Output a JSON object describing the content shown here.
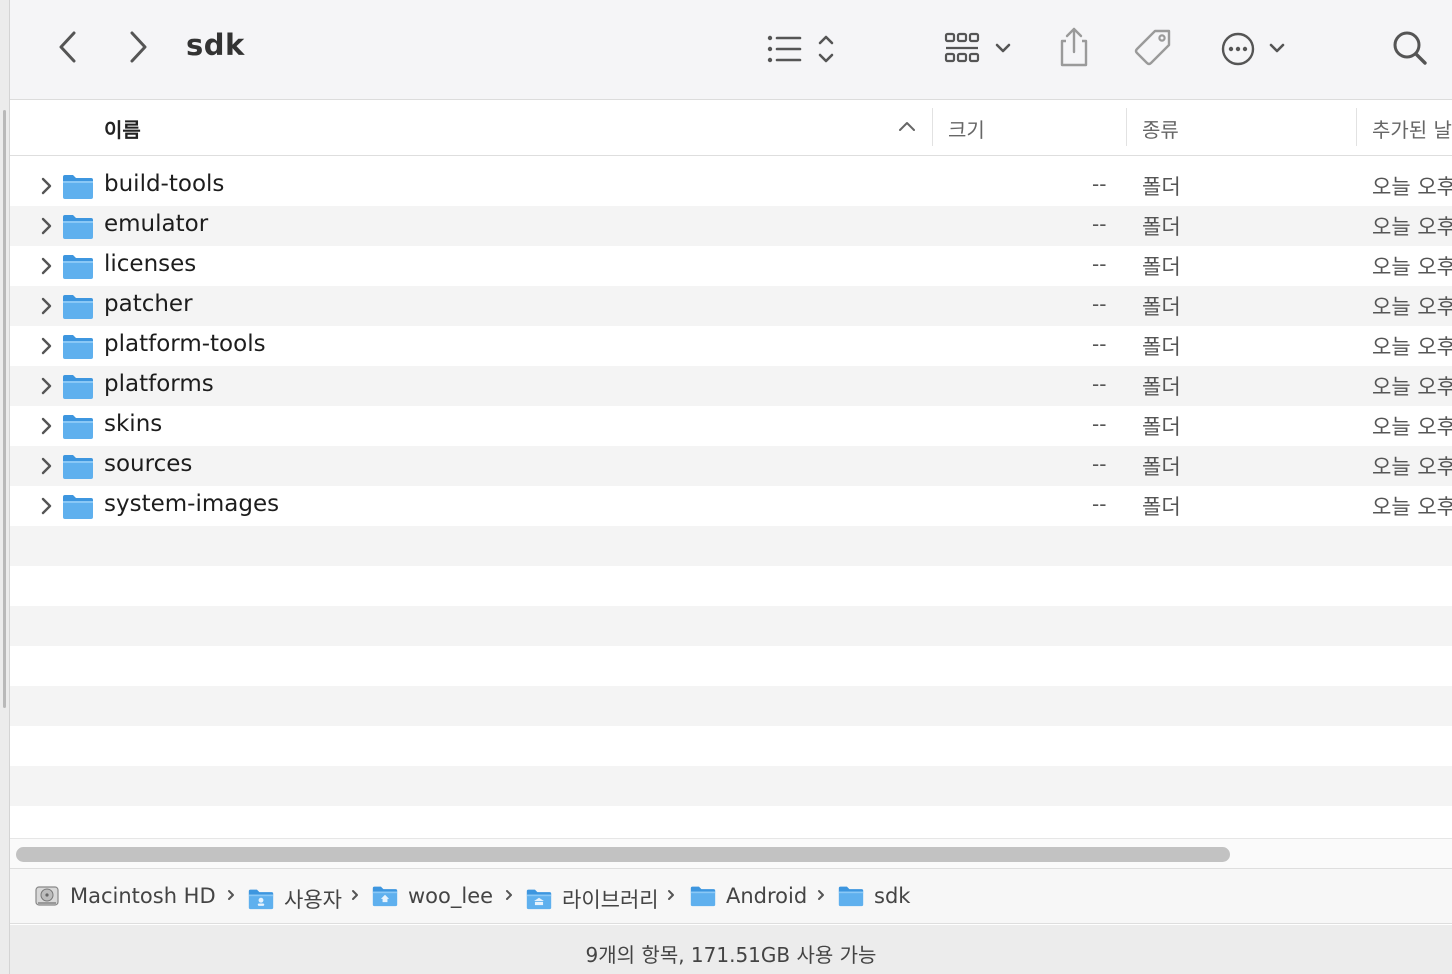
{
  "window": {
    "title": "sdk"
  },
  "toolbar": {
    "back_icon": "chevron-left-icon",
    "forward_icon": "chevron-right-icon",
    "view_list_icon": "list-view-icon",
    "group_icon": "icon-grid-icon",
    "share_icon": "share-icon",
    "tag_icon": "tag-icon",
    "more_icon": "ellipsis-circle-icon",
    "search_icon": "search-icon"
  },
  "columns": {
    "name": "이름",
    "size": "크기",
    "kind": "종류",
    "date_added": "추가된 날"
  },
  "files": [
    {
      "name": "build-tools",
      "size": "--",
      "kind": "폴더",
      "date": "오늘 오후"
    },
    {
      "name": "emulator",
      "size": "--",
      "kind": "폴더",
      "date": "오늘 오후"
    },
    {
      "name": "licenses",
      "size": "--",
      "kind": "폴더",
      "date": "오늘 오후"
    },
    {
      "name": "patcher",
      "size": "--",
      "kind": "폴더",
      "date": "오늘 오후"
    },
    {
      "name": "platform-tools",
      "size": "--",
      "kind": "폴더",
      "date": "오늘 오후"
    },
    {
      "name": "platforms",
      "size": "--",
      "kind": "폴더",
      "date": "오늘 오후"
    },
    {
      "name": "skins",
      "size": "--",
      "kind": "폴더",
      "date": "오늘 오후"
    },
    {
      "name": "sources",
      "size": "--",
      "kind": "폴더",
      "date": "오늘 오후"
    },
    {
      "name": "system-images",
      "size": "--",
      "kind": "폴더",
      "date": "오늘 오후"
    }
  ],
  "pathbar": {
    "items": [
      {
        "label": "Macintosh HD",
        "icon": "hard-drive-icon"
      },
      {
        "label": "사용자",
        "icon": "users-folder-icon"
      },
      {
        "label": "woo_lee",
        "icon": "home-folder-icon"
      },
      {
        "label": "라이브러리",
        "icon": "library-folder-icon"
      },
      {
        "label": "Android",
        "icon": "folder-icon"
      },
      {
        "label": "sdk",
        "icon": "folder-icon"
      }
    ]
  },
  "status": {
    "text": "9개의 항목, 171.51GB 사용 가능"
  },
  "colors": {
    "folder": "#5fb0ee",
    "folder_dark": "#3d96df",
    "accent": "#8e8e93"
  }
}
